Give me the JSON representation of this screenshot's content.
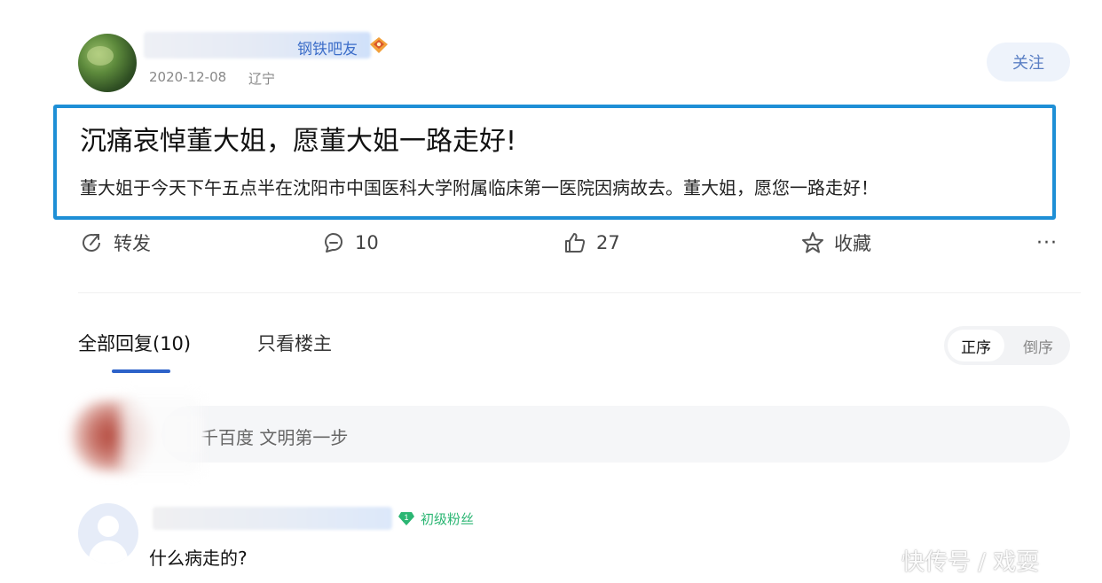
{
  "post": {
    "author_suffix": "钢铁吧友",
    "date": "2020-12-08",
    "location": "辽宁",
    "follow_label": "关注",
    "title": "沉痛哀悼董大姐，愿董大姐一路走好!",
    "body": "董大姐于今天下午五点半在沈阳市中国医科大学附属临床第一医院因病故去。董大姐，愿您一路走好！"
  },
  "actions": {
    "share_label": "转发",
    "comment_count": "10",
    "like_count": "27",
    "favorite_label": "收藏",
    "more_label": "···"
  },
  "tabs": {
    "all_replies": "全部回复(10)",
    "owner_only": "只看楼主"
  },
  "sort": {
    "asc_label": "正序",
    "desc_label": "倒序"
  },
  "reply_input": {
    "placeholder": "千百度 文明第一步"
  },
  "comment": {
    "badge": "初级粉丝",
    "text": "什么病走的?"
  },
  "watermark": "快传号 / 戏耍",
  "colors": {
    "highlight_border": "#1e8fd6",
    "tab_accent": "#2d62c9",
    "badge_green": "#2bb673",
    "username_blue": "#3d6ec9"
  }
}
